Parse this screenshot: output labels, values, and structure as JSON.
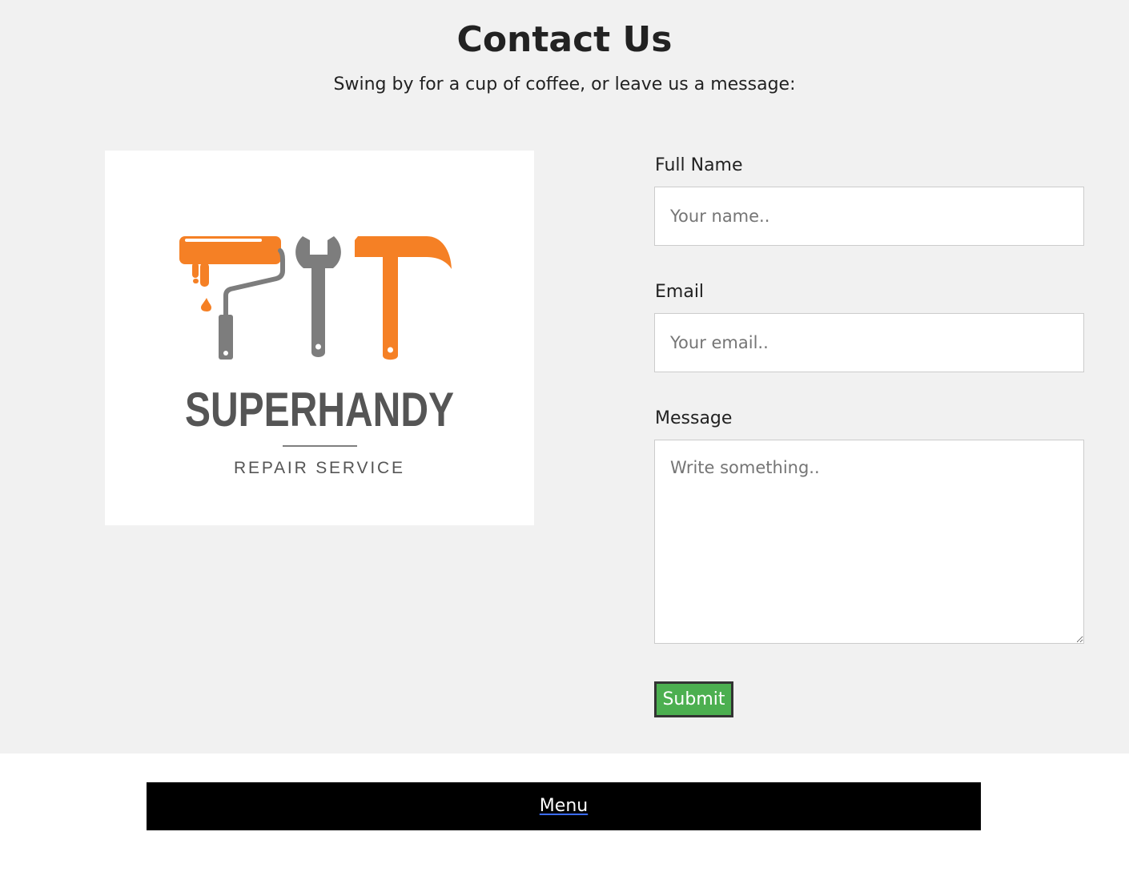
{
  "header": {
    "title": "Contact Us",
    "subtitle": "Swing by for a cup of coffee, or leave us a message:"
  },
  "logo": {
    "brand_name": "SUPERHANDY",
    "tagline": "REPAIR SERVICE",
    "colors": {
      "orange": "#f58025",
      "gray": "#7d7d7d",
      "text": "#555555"
    },
    "icons": [
      "paint-roller-icon",
      "wrench-icon",
      "hammer-icon"
    ]
  },
  "form": {
    "name_label": "Full Name",
    "name_placeholder": "Your name..",
    "email_label": "Email",
    "email_placeholder": "Your email..",
    "message_label": "Message",
    "message_placeholder": "Write something..",
    "submit_label": "Submit"
  },
  "footer": {
    "menu_label": "Menu"
  },
  "colors": {
    "section_background": "#f1f1f1",
    "submit_button": "#4caf50",
    "menu_bar": "#000000"
  }
}
